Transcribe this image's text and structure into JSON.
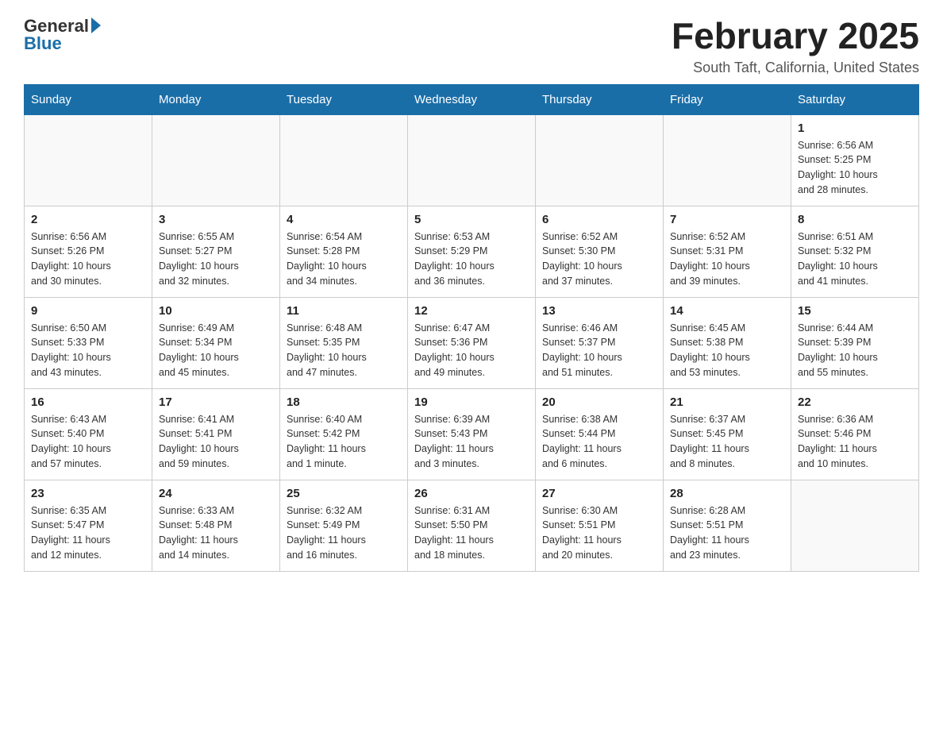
{
  "header": {
    "logo_general": "General",
    "logo_blue": "Blue",
    "month_title": "February 2025",
    "location": "South Taft, California, United States"
  },
  "weekdays": [
    "Sunday",
    "Monday",
    "Tuesday",
    "Wednesday",
    "Thursday",
    "Friday",
    "Saturday"
  ],
  "weeks": [
    {
      "days": [
        {
          "num": "",
          "info": ""
        },
        {
          "num": "",
          "info": ""
        },
        {
          "num": "",
          "info": ""
        },
        {
          "num": "",
          "info": ""
        },
        {
          "num": "",
          "info": ""
        },
        {
          "num": "",
          "info": ""
        },
        {
          "num": "1",
          "info": "Sunrise: 6:56 AM\nSunset: 5:25 PM\nDaylight: 10 hours\nand 28 minutes."
        }
      ]
    },
    {
      "days": [
        {
          "num": "2",
          "info": "Sunrise: 6:56 AM\nSunset: 5:26 PM\nDaylight: 10 hours\nand 30 minutes."
        },
        {
          "num": "3",
          "info": "Sunrise: 6:55 AM\nSunset: 5:27 PM\nDaylight: 10 hours\nand 32 minutes."
        },
        {
          "num": "4",
          "info": "Sunrise: 6:54 AM\nSunset: 5:28 PM\nDaylight: 10 hours\nand 34 minutes."
        },
        {
          "num": "5",
          "info": "Sunrise: 6:53 AM\nSunset: 5:29 PM\nDaylight: 10 hours\nand 36 minutes."
        },
        {
          "num": "6",
          "info": "Sunrise: 6:52 AM\nSunset: 5:30 PM\nDaylight: 10 hours\nand 37 minutes."
        },
        {
          "num": "7",
          "info": "Sunrise: 6:52 AM\nSunset: 5:31 PM\nDaylight: 10 hours\nand 39 minutes."
        },
        {
          "num": "8",
          "info": "Sunrise: 6:51 AM\nSunset: 5:32 PM\nDaylight: 10 hours\nand 41 minutes."
        }
      ]
    },
    {
      "days": [
        {
          "num": "9",
          "info": "Sunrise: 6:50 AM\nSunset: 5:33 PM\nDaylight: 10 hours\nand 43 minutes."
        },
        {
          "num": "10",
          "info": "Sunrise: 6:49 AM\nSunset: 5:34 PM\nDaylight: 10 hours\nand 45 minutes."
        },
        {
          "num": "11",
          "info": "Sunrise: 6:48 AM\nSunset: 5:35 PM\nDaylight: 10 hours\nand 47 minutes."
        },
        {
          "num": "12",
          "info": "Sunrise: 6:47 AM\nSunset: 5:36 PM\nDaylight: 10 hours\nand 49 minutes."
        },
        {
          "num": "13",
          "info": "Sunrise: 6:46 AM\nSunset: 5:37 PM\nDaylight: 10 hours\nand 51 minutes."
        },
        {
          "num": "14",
          "info": "Sunrise: 6:45 AM\nSunset: 5:38 PM\nDaylight: 10 hours\nand 53 minutes."
        },
        {
          "num": "15",
          "info": "Sunrise: 6:44 AM\nSunset: 5:39 PM\nDaylight: 10 hours\nand 55 minutes."
        }
      ]
    },
    {
      "days": [
        {
          "num": "16",
          "info": "Sunrise: 6:43 AM\nSunset: 5:40 PM\nDaylight: 10 hours\nand 57 minutes."
        },
        {
          "num": "17",
          "info": "Sunrise: 6:41 AM\nSunset: 5:41 PM\nDaylight: 10 hours\nand 59 minutes."
        },
        {
          "num": "18",
          "info": "Sunrise: 6:40 AM\nSunset: 5:42 PM\nDaylight: 11 hours\nand 1 minute."
        },
        {
          "num": "19",
          "info": "Sunrise: 6:39 AM\nSunset: 5:43 PM\nDaylight: 11 hours\nand 3 minutes."
        },
        {
          "num": "20",
          "info": "Sunrise: 6:38 AM\nSunset: 5:44 PM\nDaylight: 11 hours\nand 6 minutes."
        },
        {
          "num": "21",
          "info": "Sunrise: 6:37 AM\nSunset: 5:45 PM\nDaylight: 11 hours\nand 8 minutes."
        },
        {
          "num": "22",
          "info": "Sunrise: 6:36 AM\nSunset: 5:46 PM\nDaylight: 11 hours\nand 10 minutes."
        }
      ]
    },
    {
      "days": [
        {
          "num": "23",
          "info": "Sunrise: 6:35 AM\nSunset: 5:47 PM\nDaylight: 11 hours\nand 12 minutes."
        },
        {
          "num": "24",
          "info": "Sunrise: 6:33 AM\nSunset: 5:48 PM\nDaylight: 11 hours\nand 14 minutes."
        },
        {
          "num": "25",
          "info": "Sunrise: 6:32 AM\nSunset: 5:49 PM\nDaylight: 11 hours\nand 16 minutes."
        },
        {
          "num": "26",
          "info": "Sunrise: 6:31 AM\nSunset: 5:50 PM\nDaylight: 11 hours\nand 18 minutes."
        },
        {
          "num": "27",
          "info": "Sunrise: 6:30 AM\nSunset: 5:51 PM\nDaylight: 11 hours\nand 20 minutes."
        },
        {
          "num": "28",
          "info": "Sunrise: 6:28 AM\nSunset: 5:51 PM\nDaylight: 11 hours\nand 23 minutes."
        },
        {
          "num": "",
          "info": ""
        }
      ]
    }
  ]
}
